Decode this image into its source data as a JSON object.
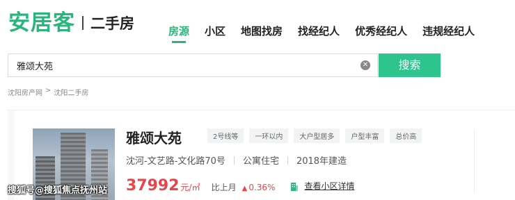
{
  "header": {
    "logo_main": "安居客",
    "logo_sub": "二手房",
    "nav": [
      {
        "label": "房源",
        "active": true
      },
      {
        "label": "小区",
        "active": false
      },
      {
        "label": "地图找房",
        "active": false
      },
      {
        "label": "找经纪人",
        "active": false
      },
      {
        "label": "优秀经纪人",
        "active": false
      },
      {
        "label": "违规经纪人",
        "active": false
      }
    ]
  },
  "search": {
    "value": "雅颂大苑",
    "button_label": "搜索"
  },
  "breadcrumb": [
    "沈阳房产网",
    ">",
    "沈阳二手房"
  ],
  "listing": {
    "title": "雅颂大苑",
    "tags": [
      "2号线等",
      "一环以内",
      "大户型居多",
      "户型丰富",
      "总价高"
    ],
    "location": "沈河-文艺路-文化路70号",
    "property_type": "公寓住宅",
    "built": "2018年建造",
    "price": "37992",
    "price_unit": "元/㎡",
    "mom_label": "比上月",
    "mom_arrow": "▲",
    "mom_value": "0.36%",
    "detail_link": "查看小区详情"
  },
  "colors": {
    "brand_green": "#2ab57d",
    "search_button": "#2dc48d",
    "price_red": "#e6464a"
  },
  "watermark": "搜狐号@搜狐焦点抚州站"
}
